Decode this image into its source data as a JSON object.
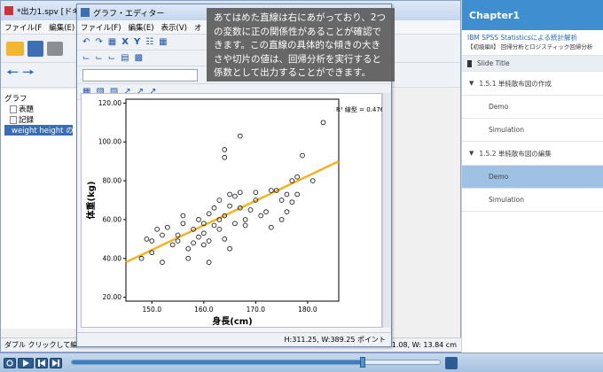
{
  "viewer": {
    "title": "*出力1.spv [ドキ",
    "menus": [
      "ファイル(F",
      "編集(E)",
      "表"
    ],
    "outline": [
      "グラフ",
      "表題",
      "記録",
      "weight height の散"
    ],
    "status": "ダブル クリックして編",
    "status_right": "1.08, W: 13.84 cm"
  },
  "editor": {
    "title": "グラフ・エディター",
    "menus": [
      "ファイル(F)",
      "編集(E)",
      "表示(V)",
      "オ"
    ],
    "status": "H:311.25, W:389.25 ポイント"
  },
  "tooltip": {
    "text": "あてはめた直線は右にあがっており、2つの変数に正の関係性があることが確認できます。この直線の具体的な傾きの大きさや切片の値は、回帰分析を実行すると係数として出力することができます。"
  },
  "chart_data": {
    "type": "scatter",
    "xlabel": "身長(cm)",
    "ylabel": "体重(kg)",
    "xlim": [
      145,
      186
    ],
    "ylim": [
      18,
      122
    ],
    "xticks": [
      150.0,
      160.0,
      170.0,
      180.0
    ],
    "yticks": [
      20.0,
      40.0,
      60.0,
      80.0,
      100.0,
      120.0
    ],
    "xtick_labels": [
      "150.0",
      "160.0",
      "170.0",
      "180.0"
    ],
    "ytick_labels": [
      "20.00",
      "40.00",
      "60.00",
      "80.00",
      "100.00",
      "120.00"
    ],
    "r2_label": "R² 線型 = 0.476",
    "fit_line": {
      "x": [
        145,
        186
      ],
      "y": [
        38,
        90
      ],
      "color": "#f0b323"
    },
    "points": [
      [
        148,
        40
      ],
      [
        149,
        50
      ],
      [
        150,
        49
      ],
      [
        150,
        43
      ],
      [
        151,
        55
      ],
      [
        152,
        38
      ],
      [
        152,
        52
      ],
      [
        153,
        56
      ],
      [
        154,
        47
      ],
      [
        155,
        49
      ],
      [
        155,
        52
      ],
      [
        156,
        58
      ],
      [
        156,
        62
      ],
      [
        157,
        45
      ],
      [
        157,
        40
      ],
      [
        158,
        48
      ],
      [
        158,
        55
      ],
      [
        159,
        51
      ],
      [
        159,
        60
      ],
      [
        160,
        53
      ],
      [
        160,
        58
      ],
      [
        160,
        47
      ],
      [
        161,
        63
      ],
      [
        161,
        38
      ],
      [
        161,
        49
      ],
      [
        162,
        57
      ],
      [
        162,
        66
      ],
      [
        163,
        70
      ],
      [
        163,
        60
      ],
      [
        163,
        55
      ],
      [
        164,
        50
      ],
      [
        164,
        62
      ],
      [
        165,
        67
      ],
      [
        165,
        73
      ],
      [
        165,
        45
      ],
      [
        166,
        58
      ],
      [
        166,
        72
      ],
      [
        167,
        66
      ],
      [
        167,
        74
      ],
      [
        167,
        103
      ],
      [
        168,
        60
      ],
      [
        168,
        57
      ],
      [
        169,
        65
      ],
      [
        170,
        74
      ],
      [
        170,
        70
      ],
      [
        171,
        62
      ],
      [
        172,
        64
      ],
      [
        173,
        56
      ],
      [
        173,
        75
      ],
      [
        174,
        75
      ],
      [
        175,
        60
      ],
      [
        175,
        70
      ],
      [
        176,
        64
      ],
      [
        176,
        73
      ],
      [
        177,
        80
      ],
      [
        177,
        69
      ],
      [
        178,
        82
      ],
      [
        178,
        73
      ],
      [
        179,
        93
      ],
      [
        181,
        80
      ],
      [
        183,
        110
      ],
      [
        164,
        92
      ],
      [
        164,
        96
      ]
    ]
  },
  "sidebar": {
    "chapter": "Chapter1",
    "course_title": "IBM SPSS Statisticsによる統計解析",
    "course_sub": "【初級編Ⅱ】 回帰分析とロジスティック回帰分析",
    "slide_title": "Slide Title",
    "sections": [
      {
        "label": "1.5.1 単純散布図の作成",
        "items": [
          "Demo",
          "Simulation"
        ]
      },
      {
        "label": "1.5.2 単純散布図の編集",
        "items": [
          "Demo",
          "Simulation"
        ]
      }
    ],
    "selected_item": "1.5.2-Demo"
  },
  "player": {
    "progress": 0.79
  },
  "colors": {
    "accent": "#3e8ed0",
    "selected": "#9ec1e4",
    "fit_line": "#f0b323"
  }
}
